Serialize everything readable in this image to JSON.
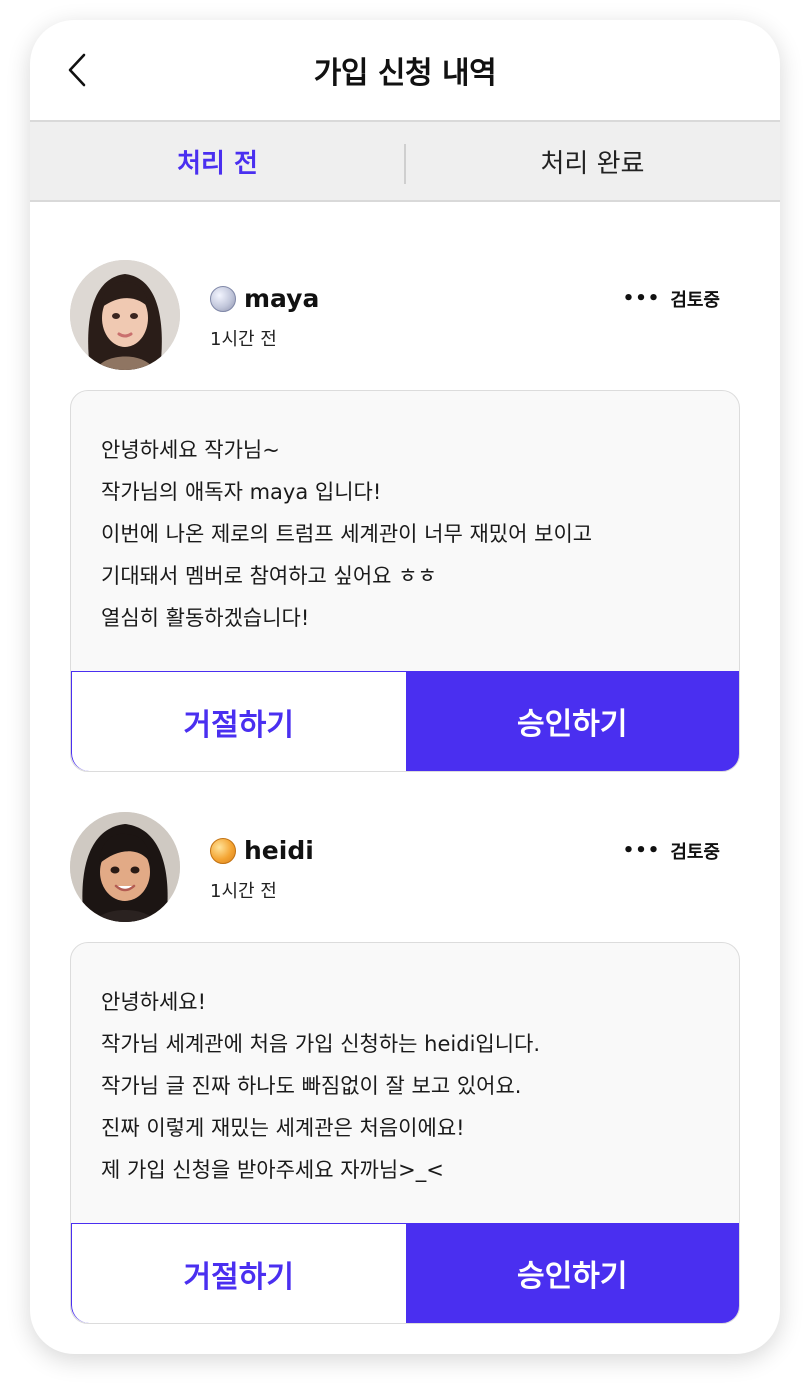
{
  "header": {
    "title": "가입 신청 내역"
  },
  "tabs": [
    {
      "label": "처리 전",
      "active": true
    },
    {
      "label": "처리 완료",
      "active": false
    }
  ],
  "colors": {
    "accent": "#4a2ff0"
  },
  "requests": [
    {
      "username": "maya",
      "badge": "silver-badge-icon",
      "time": "1시간 전",
      "status": "검토중",
      "message": [
        "안녕하세요 작가님~",
        "작가님의 애독자 maya 입니다!",
        "이번에 나온 제로의 트럼프 세계관이 너무 재밌어 보이고",
        "기대돼서 멤버로 참여하고 싶어요 ㅎㅎ",
        "열심히 활동하겠습니다!"
      ],
      "reject_label": "거절하기",
      "accept_label": "승인하기"
    },
    {
      "username": "heidi",
      "badge": "gold-badge-icon",
      "time": "1시간 전",
      "status": "검토중",
      "message": [
        "안녕하세요!",
        "작가님 세계관에 처음 가입 신청하는 heidi입니다.",
        "작가님 글 진짜 하나도 빠짐없이 잘 보고 있어요.",
        "진짜 이렇게 재밌는 세계관은 처음이에요!",
        "제 가입 신청을 받아주세요 자까님>_<"
      ],
      "reject_label": "거절하기",
      "accept_label": "승인하기"
    }
  ]
}
